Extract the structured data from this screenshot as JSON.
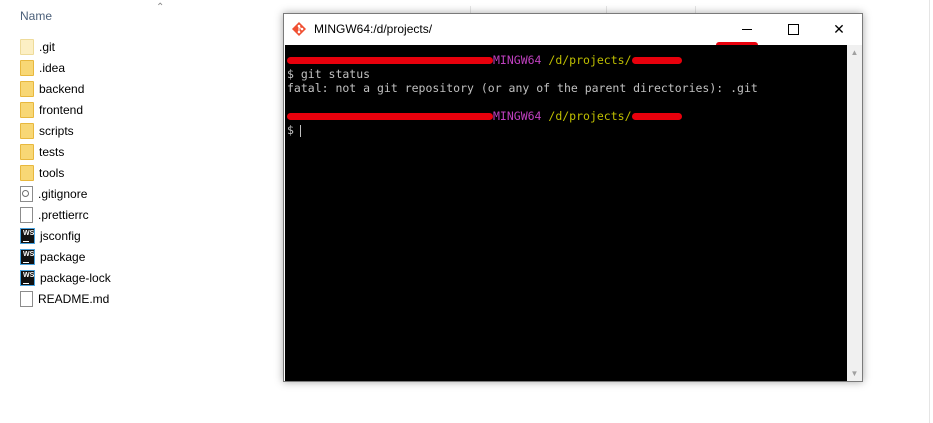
{
  "explorer": {
    "column_name": "Name",
    "files": [
      {
        "name": ".git",
        "icon": "folder-pale-icon"
      },
      {
        "name": ".idea",
        "icon": "folder-icon"
      },
      {
        "name": "backend",
        "icon": "folder-icon"
      },
      {
        "name": "frontend",
        "icon": "folder-icon"
      },
      {
        "name": "scripts",
        "icon": "folder-icon"
      },
      {
        "name": "tests",
        "icon": "folder-icon"
      },
      {
        "name": "tools",
        "icon": "folder-icon"
      },
      {
        "name": ".gitignore",
        "icon": "gear-file-icon"
      },
      {
        "name": ".prettierrc",
        "icon": "file-icon"
      },
      {
        "name": "jsconfig",
        "icon": "webstorm-icon"
      },
      {
        "name": "package",
        "icon": "webstorm-icon"
      },
      {
        "name": "package-lock",
        "icon": "webstorm-icon"
      },
      {
        "name": "README.md",
        "icon": "file-icon"
      }
    ]
  },
  "terminal_window": {
    "title": "MINGW64:/d/projects/",
    "minimize_label": "",
    "maximize_label": "",
    "close_label": "✕",
    "prompt_env": "MINGW64",
    "prompt_path": "/d/projects/",
    "lines": {
      "command": "$ git status",
      "error": "fatal: not a git repository (or any of the parent directories): .git",
      "prompt_symbol": "$"
    }
  },
  "colors": {
    "terminal_bg": "#000000",
    "prompt_env": "#bf40bf",
    "prompt_path": "#bfbf00",
    "redaction": "#e8000c"
  }
}
